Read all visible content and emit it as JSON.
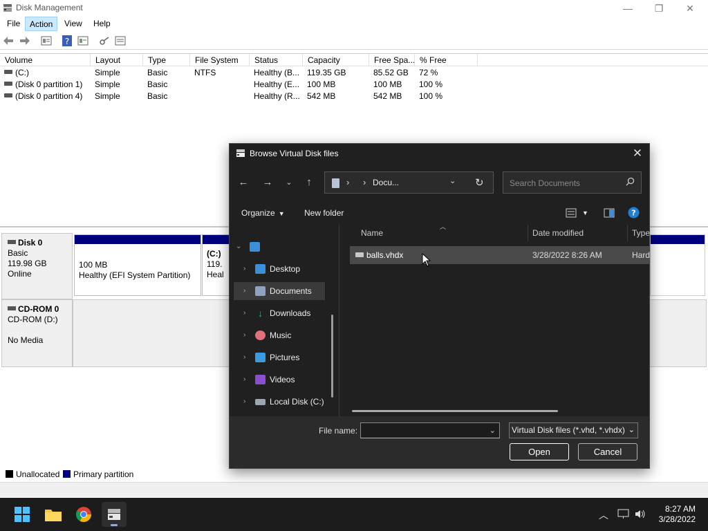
{
  "window": {
    "title": "Disk Management",
    "minimize": "—",
    "restore": "❐",
    "close": "✕"
  },
  "menu": [
    "File",
    "Action",
    "View",
    "Help"
  ],
  "toolbar": {
    "icons": [
      "back-arrow-icon",
      "forward-arrow-icon",
      "properties-icon",
      "help-icon",
      "console-icon",
      "key-icon",
      "list-icon"
    ]
  },
  "volumes": {
    "columns": [
      "Volume",
      "Layout",
      "Type",
      "File System",
      "Status",
      "Capacity",
      "Free Spa...",
      "% Free"
    ],
    "rows": [
      [
        "(C:)",
        "Simple",
        "Basic",
        "NTFS",
        "Healthy (B...",
        "119.35 GB",
        "85.52 GB",
        "72 %"
      ],
      [
        "(Disk 0 partition 1)",
        "Simple",
        "Basic",
        "",
        "Healthy (E...",
        "100 MB",
        "100 MB",
        "100 %"
      ],
      [
        "(Disk 0 partition 4)",
        "Simple",
        "Basic",
        "",
        "Healthy (R...",
        "542 MB",
        "542 MB",
        "100 %"
      ]
    ]
  },
  "disks": {
    "disk0": {
      "name": "Disk 0",
      "type": "Basic",
      "size": "119.98 GB",
      "state": "Online",
      "partitions": [
        {
          "line1": "100 MB",
          "line2": "Healthy (EFI System Partition)"
        },
        {
          "line1": "(C:)",
          "line2": "119.",
          "line3": "Heal"
        }
      ]
    },
    "cdrom0": {
      "name": "CD-ROM 0",
      "type": "CD-ROM (D:)",
      "media": "No Media"
    }
  },
  "legend": [
    {
      "label": "Unallocated",
      "color": "#000000"
    },
    {
      "label": "Primary partition",
      "color": "#00007f"
    }
  ],
  "dialog": {
    "title": "Browse Virtual Disk files",
    "address": {
      "separator": "›",
      "folder": "Docu..."
    },
    "search_placeholder": "Search Documents",
    "organize": "Organize",
    "new_folder": "New folder",
    "nav": [
      {
        "label": "Desktop",
        "icon": "desktop-icon",
        "color": "#3a8fd8"
      },
      {
        "label": "Documents",
        "icon": "documents-icon",
        "color": "#8fa3c0",
        "selected": true
      },
      {
        "label": "Downloads",
        "icon": "download-icon",
        "color": "#3cb371"
      },
      {
        "label": "Music",
        "icon": "music-icon",
        "color": "#e0707a"
      },
      {
        "label": "Pictures",
        "icon": "pictures-icon",
        "color": "#3a9be0"
      },
      {
        "label": "Videos",
        "icon": "videos-icon",
        "color": "#8a4fd0"
      },
      {
        "label": "Local Disk (C:)",
        "icon": "drive-icon",
        "color": "#9aa6b4"
      }
    ],
    "columns": {
      "name": "Name",
      "date": "Date modified",
      "type": "Type"
    },
    "files": [
      {
        "name": "balls.vhdx",
        "date": "3/28/2022 8:26 AM",
        "type": "Hard"
      }
    ],
    "file_name_label": "File name:",
    "file_name_value": "",
    "file_type": "Virtual Disk files (*.vhd, *.vhdx)",
    "open": "Open",
    "cancel": "Cancel"
  },
  "taskbar": {
    "apps": [
      "start-icon",
      "file-explorer-icon",
      "chrome-icon",
      "disk-management-icon"
    ],
    "time": "8:27 AM",
    "date": "3/28/2022"
  }
}
